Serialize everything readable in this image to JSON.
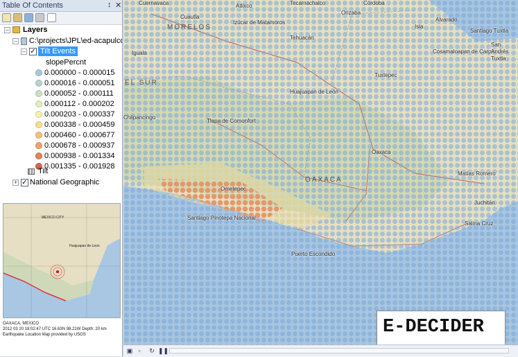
{
  "toc": {
    "title": "Table Of Contents",
    "layers_label": "Layers",
    "dataframe_path": "C:\\projects\\JPL\\ed-acapulco\\Ac",
    "tilt_events_label": "Tilt Events",
    "field_label": "slopePercnt",
    "classes": [
      {
        "label": "0.000000 - 0.000015",
        "color": "#a8c8df"
      },
      {
        "label": "0.000016 - 0.000051",
        "color": "#b6d5cf"
      },
      {
        "label": "0.000052 - 0.000111",
        "color": "#c8e1c2"
      },
      {
        "label": "0.000112 - 0.000202",
        "color": "#dfeeb8"
      },
      {
        "label": "0.000203 - 0.000337",
        "color": "#f3f2a8"
      },
      {
        "label": "0.000338 - 0.000459",
        "color": "#f8de8d"
      },
      {
        "label": "0.000460 - 0.000677",
        "color": "#f4c07a"
      },
      {
        "label": "0.000678 - 0.000937",
        "color": "#eba46c"
      },
      {
        "label": "0.000938 - 0.001334",
        "color": "#e2845c"
      },
      {
        "label": "0.001335 - 0.001928",
        "color": "#d6674e"
      }
    ],
    "tilt_label": "Tilt",
    "national_geographic_label": "National Geographic"
  },
  "thumbnail": {
    "caption_line1": "OAXACA, MEXICO",
    "caption_line2": "2012 03 20  18:02:47 UTC  16.63N 98.21W Depth: 20 km",
    "caption_line3": "Earthquake Location     Map provided by USGS",
    "city_label": "Huajuapan de Leon",
    "mexico_city_label": "MEXICO CITY"
  },
  "map": {
    "region_labels": [
      "MORELOS",
      "EL SUR",
      "OAXACA"
    ],
    "cities": [
      "Cuernavaca",
      "Cuautla",
      "Atlixco",
      "Tecamachalco",
      "Orizaba",
      "Córdoba",
      "Alvarado",
      "Izúcar de Matamoros",
      "Tehuacán",
      "Tlapa de Comonfort",
      "Huajuapan de León",
      "Iguala",
      "Chilpancingo",
      "Ometepec",
      "Santiago Pinotepa Nacional",
      "Puerto Escondido",
      "Oaxaca",
      "Tuxtepec",
      "Cosamaloapan de Carpio",
      "Santiago Tuxtla",
      "San Andrés Tuxtla",
      "Isla",
      "Matías Romero",
      "Juchitán",
      "Salina Cruz"
    ],
    "logo_text": "E-DECIDER"
  },
  "colors": {
    "accent_selected": "#3399ff",
    "ocean": "#a9c6e1",
    "land": "#e9e3c8"
  }
}
